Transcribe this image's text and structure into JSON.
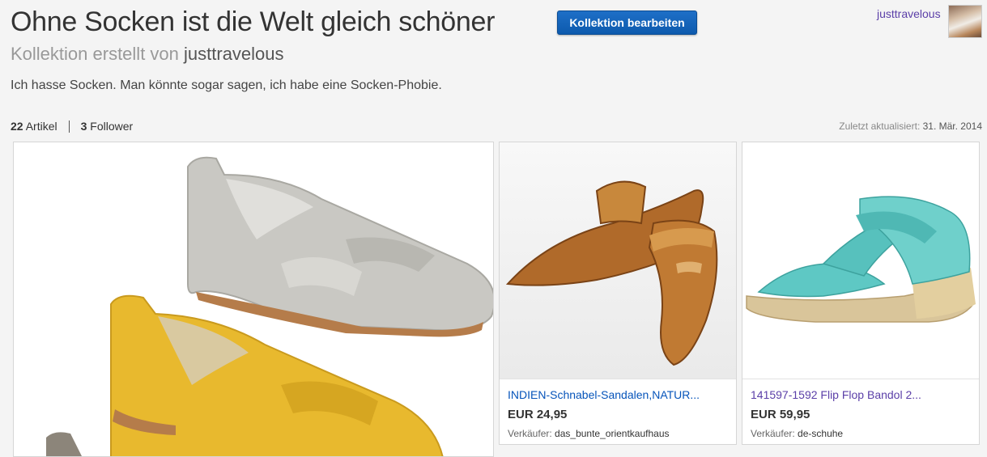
{
  "header": {
    "title": "Ohne Socken ist die Welt gleich schöner",
    "edit_button": "Kollektion bearbeiten",
    "user": "justtravelous",
    "subtitle_prefix": "Kollektion erstellt von",
    "subtitle_owner": "justtravelous",
    "description": "Ich hasse Socken. Man könnte sogar sagen, ich habe eine Socken-Phobie."
  },
  "stats": {
    "items_count": "22",
    "items_label": "Artikel",
    "followers_count": "3",
    "followers_label": "Follower",
    "updated_label": "Zuletzt aktualisiert",
    "updated_date": "31. Mär. 2014"
  },
  "items": [
    {
      "title": "INDIEN-Schnabel-Sandalen,NATUR...",
      "price": "EUR 24,95",
      "seller_label": "Verkäufer:",
      "seller": "das_bunte_orientkaufhaus"
    },
    {
      "title": "141597-1592 Flip Flop Bandol 2...",
      "price": "EUR 59,95",
      "seller_label": "Verkäufer:",
      "seller": "de-schuhe"
    }
  ],
  "colors": {
    "accent_blue": "#0654ba",
    "visited_purple": "#5b3fa8",
    "button_blue": "#1e6fc7"
  }
}
